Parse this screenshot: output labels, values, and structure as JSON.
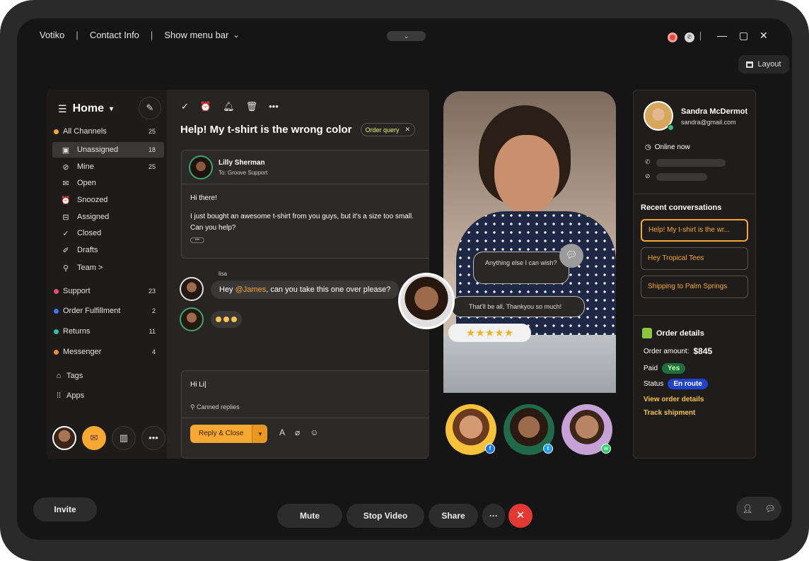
{
  "topbar": {
    "app_name": "Votiko",
    "contact_info": "Contact Info",
    "show_menu_bar": "Show menu bar",
    "layout_label": "Layout"
  },
  "sidebar": {
    "title": "Home",
    "items": [
      {
        "label": "All Channels",
        "count": "25"
      },
      {
        "label": "Unassigned",
        "count": "18"
      },
      {
        "label": "Mine",
        "count": "25"
      },
      {
        "label": "Open",
        "count": ""
      },
      {
        "label": "Snoozed",
        "count": ""
      },
      {
        "label": "Assigned",
        "count": ""
      },
      {
        "label": "Closed",
        "count": ""
      },
      {
        "label": "Drafts",
        "count": ""
      },
      {
        "label": "Team >",
        "count": ""
      },
      {
        "label": "Support",
        "count": "23"
      },
      {
        "label": "Order Fulfillment",
        "count": "2"
      },
      {
        "label": "Returns",
        "count": "11"
      },
      {
        "label": "Messenger",
        "count": "4"
      },
      {
        "label": "Tags",
        "count": ""
      },
      {
        "label": "Apps",
        "count": ""
      }
    ]
  },
  "conversation": {
    "subject": "Help! My t-shirt is the wrong color",
    "tag": "Order query",
    "sender": "Lilly Sherman",
    "to": "To: Groove Support",
    "greeting": "Hi there!",
    "body": "I just bought an awesome t-shirt from you guys, but it's a size too small. Can you help?",
    "more": "•••",
    "note_author": "lisa",
    "note_prefix": "Hey ",
    "note_mention": "@James",
    "note_suffix": ", can you take this one over please?",
    "draft": "Hi Li|",
    "canned": "Canned replies",
    "reply_close": "Reply & Close"
  },
  "video": {
    "bubble1": "Anything else I can wish?",
    "bubble2": "That'll be all, Thankyou so much!",
    "stars": "★★★★★",
    "participants": [
      {
        "social": "facebook",
        "colors": [
          "#f5c23a",
          "#d6883a"
        ]
      },
      {
        "social": "twitter",
        "colors": [
          "#1f6a4a",
          "#4b2a1b"
        ]
      },
      {
        "social": "whatsapp",
        "colors": [
          "#c7a2d6",
          "#8d5d4a"
        ]
      }
    ]
  },
  "customer": {
    "name": "Sandra McDermot",
    "email": "sandra@gmail.com",
    "status": "Online now",
    "recent_title": "Recent conversations",
    "recent": [
      "Help! My t-shirt is the wr...",
      "Hey Tropical Tees",
      "Shipping to Palm Springs"
    ],
    "order_title": "Order details",
    "order_amount_label": "Order amount:",
    "order_amount": "$845",
    "paid_label": "Paid",
    "paid_value": "Yes",
    "status_label": "Status",
    "status_value": "En route",
    "view_order": "View order details",
    "track": "Track shipment"
  },
  "bottombar": {
    "invite": "Invite",
    "mute": "Mute",
    "stop_video": "Stop Video",
    "share": "Share",
    "more": "···",
    "end": "✕"
  },
  "colors": {
    "accent": "#f7a833",
    "end_call": "#e23a32",
    "online": "#34c17a",
    "status_blue": "#1f43c9"
  }
}
